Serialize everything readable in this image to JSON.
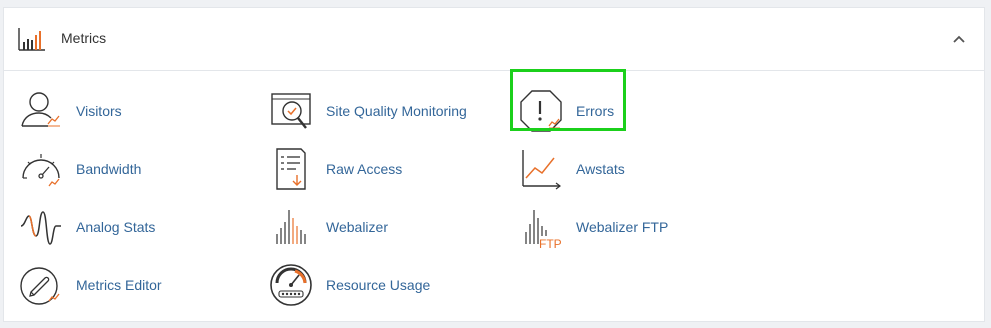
{
  "panel": {
    "title": "Metrics",
    "header_icon": "bar-chart-icon",
    "collapse_icon": "chevron-up-icon"
  },
  "colors": {
    "link": "#336699",
    "accent": "#e8702a",
    "highlight": "#1bd01b"
  },
  "items": [
    {
      "label": "Visitors",
      "icon": "visitors-icon"
    },
    {
      "label": "Site Quality Monitoring",
      "icon": "site-quality-icon"
    },
    {
      "label": "Errors",
      "icon": "errors-icon"
    },
    {
      "label": "Bandwidth",
      "icon": "bandwidth-icon"
    },
    {
      "label": "Raw Access",
      "icon": "raw-access-icon"
    },
    {
      "label": "Awstats",
      "icon": "awstats-icon"
    },
    {
      "label": "Analog Stats",
      "icon": "analog-stats-icon"
    },
    {
      "label": "Webalizer",
      "icon": "webalizer-icon"
    },
    {
      "label": "Webalizer FTP",
      "icon": "webalizer-ftp-icon",
      "icon_text": "FTP"
    },
    {
      "label": "Metrics Editor",
      "icon": "metrics-editor-icon"
    },
    {
      "label": "Resource Usage",
      "icon": "resource-usage-icon"
    }
  ]
}
